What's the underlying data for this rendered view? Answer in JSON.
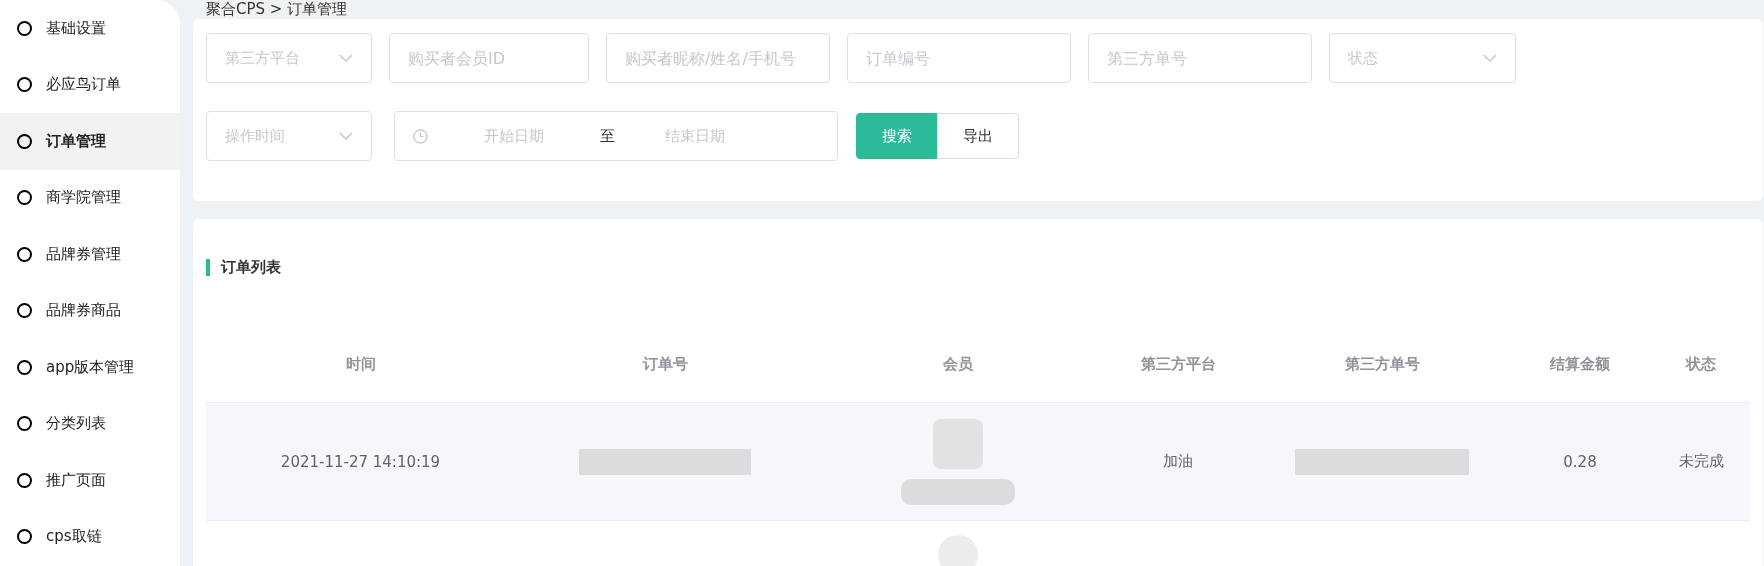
{
  "sidebar": {
    "items": [
      {
        "label": "基础设置",
        "selected": false
      },
      {
        "label": "必应鸟订单",
        "selected": false
      },
      {
        "label": "订单管理",
        "selected": true
      },
      {
        "label": "商学院管理",
        "selected": false
      },
      {
        "label": "品牌券管理",
        "selected": false
      },
      {
        "label": "品牌券商品",
        "selected": false
      },
      {
        "label": "app版本管理",
        "selected": false
      },
      {
        "label": "分类列表",
        "selected": false
      },
      {
        "label": "推广页面",
        "selected": false
      },
      {
        "label": "cps取链",
        "selected": false
      }
    ]
  },
  "breadcrumb": "聚合CPS > 订单管理",
  "filters": [
    {
      "kind": "select",
      "placeholder": "第三方平台"
    },
    {
      "kind": "input",
      "placeholder": "购买者会员ID"
    },
    {
      "kind": "input",
      "placeholder": "购买者昵称/姓名/手机号"
    },
    {
      "kind": "input",
      "placeholder": "订单编号"
    },
    {
      "kind": "input",
      "placeholder": "第三方单号"
    },
    {
      "kind": "select",
      "placeholder": "状态"
    },
    {
      "kind": "select",
      "placeholder": "操作时间"
    },
    {
      "kind": "daterange",
      "start_placeholder": "开始日期",
      "separator": "至",
      "end_placeholder": "结束日期"
    }
  ],
  "buttons": [
    {
      "label": "搜索",
      "kind": "primary"
    },
    {
      "label": "导出",
      "kind": "default"
    }
  ],
  "table": {
    "title": "订单列表",
    "columns": [
      "时间",
      "订单号",
      "会员",
      "第三方平台",
      "第三方单号",
      "结算金额",
      "状态"
    ],
    "rows": [
      {
        "kind": "full",
        "time": "2021-11-27 14:10:19",
        "platform": "加油",
        "amount": "0.28",
        "status": "未完成"
      },
      {
        "kind": "cut_off"
      }
    ]
  }
}
